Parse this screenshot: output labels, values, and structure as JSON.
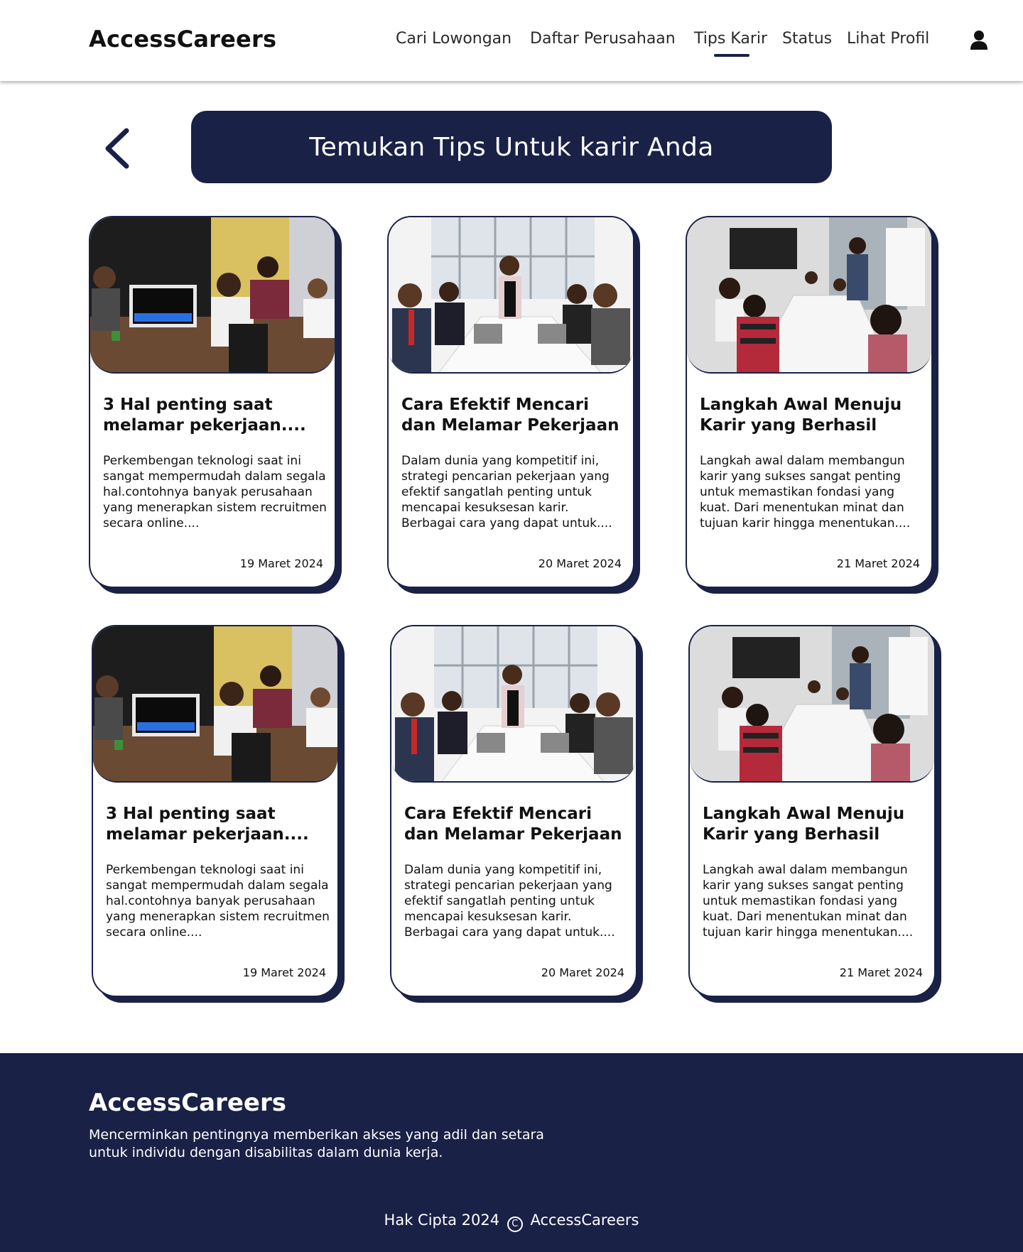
{
  "header": {
    "brand": "AccessCareers",
    "nav": [
      {
        "label": "Cari Lowongan",
        "active": false
      },
      {
        "label": "Daftar Perusahaan",
        "active": false
      },
      {
        "label": "Tips Karir",
        "active": true
      },
      {
        "label": "Status",
        "active": false
      },
      {
        "label": "Lihat Profil",
        "active": false
      }
    ],
    "user_icon": "user-icon"
  },
  "page": {
    "back_icon": "chevron-left-icon",
    "title": "Temukan Tips Untuk karir Anda"
  },
  "cards": [
    {
      "title": "3 Hal penting saat melamar pekerjaan....",
      "excerpt": "Perkembengan teknologi saat ini sangat mempermudah dalam segala hal.contohnya banyak perusahaan yang menerapkan sistem recruitmen secara online....",
      "date": "19 Maret 2024",
      "image": "team-meeting-photo"
    },
    {
      "title": "Cara Efektif Mencari dan Melamar Pekerjaan",
      "excerpt": "Dalam dunia yang kompetitif ini, strategi pencarian pekerjaan yang efektif sangatlah penting untuk mencapai kesuksesan karir. Berbagai cara yang dapat untuk....",
      "date": "20 Maret 2024",
      "image": "office-group-photo"
    },
    {
      "title": "Langkah Awal Menuju Karir yang Berhasil",
      "excerpt": "Langkah awal dalam membangun karir yang sukses sangat penting untuk memastikan fondasi yang kuat. Dari menentukan minat dan tujuan karir hingga menentukan....",
      "date": "21 Maret 2024",
      "image": "presentation-photo"
    },
    {
      "title": "3 Hal penting saat melamar pekerjaan....",
      "excerpt": "Perkembengan teknologi saat ini sangat mempermudah dalam segala hal.contohnya banyak perusahaan yang menerapkan sistem recruitmen secara online....",
      "date": "19 Maret 2024",
      "image": "team-meeting-photo"
    },
    {
      "title": "Cara Efektif Mencari dan Melamar Pekerjaan",
      "excerpt": "Dalam dunia yang kompetitif ini, strategi pencarian pekerjaan yang efektif sangatlah penting untuk mencapai kesuksesan karir. Berbagai cara yang dapat untuk....",
      "date": "20 Maret 2024",
      "image": "office-group-photo"
    },
    {
      "title": "Langkah Awal Menuju Karir yang Berhasil",
      "excerpt": "Langkah awal dalam membangun karir yang sukses sangat penting untuk memastikan fondasi yang kuat. Dari menentukan minat dan tujuan karir hingga menentukan....",
      "date": "21 Maret 2024",
      "image": "presentation-photo"
    }
  ],
  "footer": {
    "brand": "AccessCareers",
    "description": "Mencerminkan pentingnya memberikan akses yang adil dan setara untuk individu dengan disabilitas dalam dunia kerja.",
    "copyright_prefix": "Hak Cipta 2024",
    "copyright_symbol": "C",
    "copyright_suffix": "AccessCareers"
  },
  "colors": {
    "primary": "#1a2147",
    "background": "#ffffff",
    "text": "#111111"
  }
}
